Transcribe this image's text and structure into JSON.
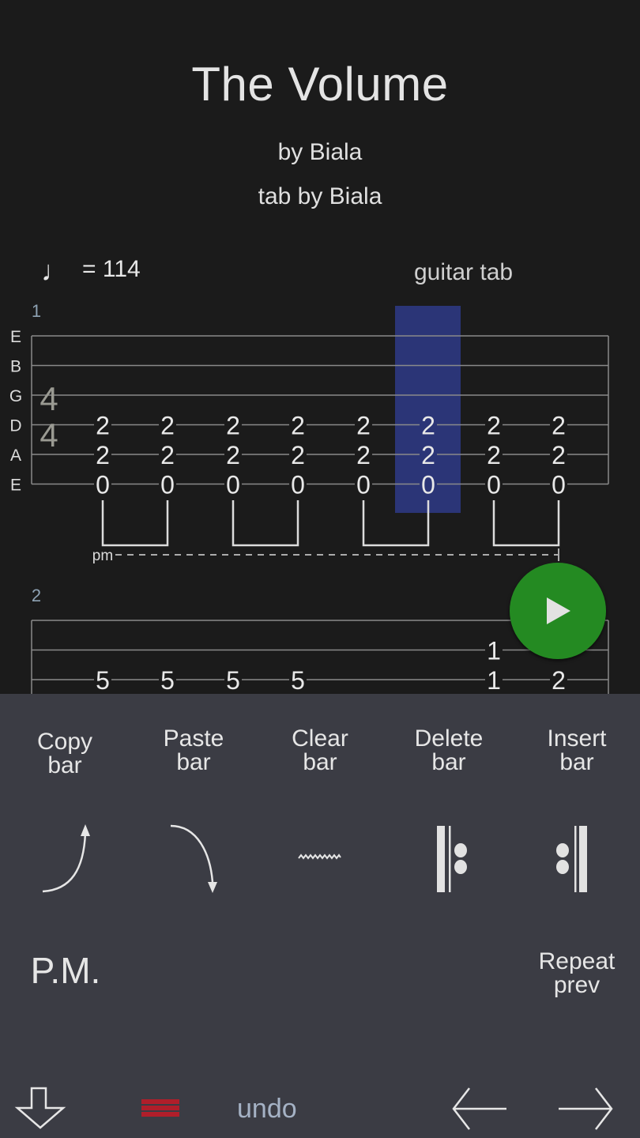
{
  "song": {
    "title": "The Volume",
    "artist": "by Biala",
    "tabber": "tab by Biala",
    "tempo_symbol": "♩",
    "tempo": "= 114",
    "instrument": "guitar tab"
  },
  "score": {
    "string_names": [
      "E",
      "B",
      "G",
      "D",
      "A",
      "E"
    ],
    "time_signature": {
      "top": "4",
      "bottom": "4"
    },
    "palm_mute_label": "pm",
    "bars": [
      {
        "number": "1",
        "beats": [
          {
            "frets": {
              "D": "2",
              "A": "2",
              "E_low": "0"
            }
          },
          {
            "frets": {
              "D": "2",
              "A": "2",
              "E_low": "0"
            }
          },
          {
            "frets": {
              "D": "2",
              "A": "2",
              "E_low": "0"
            }
          },
          {
            "frets": {
              "D": "2",
              "A": "2",
              "E_low": "0"
            }
          },
          {
            "frets": {
              "D": "2",
              "A": "2",
              "E_low": "0"
            }
          },
          {
            "frets": {
              "D": "2",
              "A": "2",
              "E_low": "0"
            },
            "selected": true
          },
          {
            "frets": {
              "D": "2",
              "A": "2",
              "E_low": "0"
            }
          },
          {
            "frets": {
              "D": "2",
              "A": "2",
              "E_low": "0"
            }
          }
        ]
      },
      {
        "number": "2",
        "beats": [
          {
            "frets": {
              "G": "5"
            }
          },
          {
            "frets": {
              "G": "5"
            }
          },
          {
            "frets": {
              "G": "5"
            }
          },
          {
            "frets": {
              "G": "5"
            }
          },
          {
            "frets": {}
          },
          {
            "frets": {}
          },
          {
            "frets": {
              "B": "1",
              "G": "1"
            }
          },
          {
            "frets": {
              "G": "2"
            }
          }
        ]
      }
    ]
  },
  "panel": {
    "row1": [
      {
        "label": "Copy\nbar",
        "name": "copy-bar-button"
      },
      {
        "label": "Paste\nbar",
        "name": "paste-bar-button"
      },
      {
        "label": "Clear\nbar",
        "name": "clear-bar-button"
      },
      {
        "label": "Delete\nbar",
        "name": "delete-bar-button"
      },
      {
        "label": "Insert\nbar",
        "name": "insert-bar-button"
      }
    ],
    "row2_icons": [
      "bend-up-icon",
      "release-down-icon",
      "vibrato-icon",
      "repeat-start-icon",
      "repeat-end-icon"
    ],
    "palm_mute": "P.M.",
    "repeat_prev": "Repeat\nprev",
    "undo": "undo"
  },
  "colors": {
    "selection": "#2b3577",
    "play": "#248a22",
    "menu_accent": "#b01e2a",
    "panel_bg": "#3b3c44",
    "score_bg": "#1b1b1b"
  }
}
